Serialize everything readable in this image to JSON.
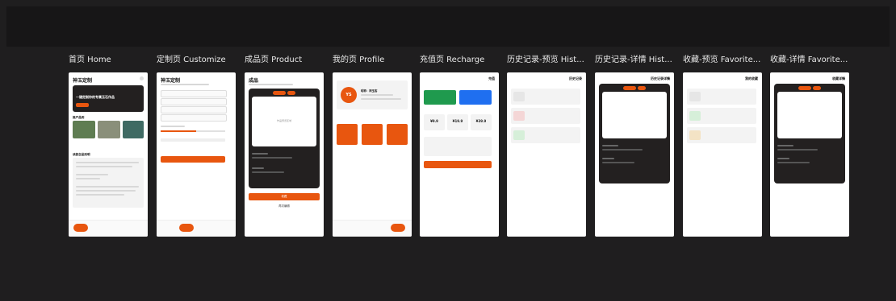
{
  "frames": [
    {
      "title": "首页 Home"
    },
    {
      "title": "定制页 Customize"
    },
    {
      "title": "成品页 Product"
    },
    {
      "title": "我的页 Profile"
    },
    {
      "title": "充值页 Recharge"
    },
    {
      "title": "历史记录-预览 Hist..."
    },
    {
      "title": "历史记录-详情 Hist..."
    },
    {
      "title": "收藏-预览 Favorite..."
    },
    {
      "title": "收藏-详情 Favorite..."
    }
  ],
  "home": {
    "app_title": "神玉定制",
    "hero_title": "一键定制你的专属玉石作品",
    "section_featured": "推产品例",
    "section_guide": "读韵怎品则明"
  },
  "customize": {
    "title": "神玉定制"
  },
  "product": {
    "title": "成品",
    "btn_primary": "收藏",
    "btn_secondary": "再次编辑",
    "preview_text": "作品预览区域"
  },
  "profile": {
    "avatar": "YS",
    "username": "昵称：神玉客"
  },
  "recharge": {
    "title": "充值",
    "prices": [
      "¥9.9",
      "¥19.9",
      "¥39.9"
    ]
  },
  "history": {
    "title": "历史记录",
    "detail_title": "历史记录详情"
  },
  "favorites": {
    "title": "我的收藏",
    "detail_title": "收藏详情"
  }
}
